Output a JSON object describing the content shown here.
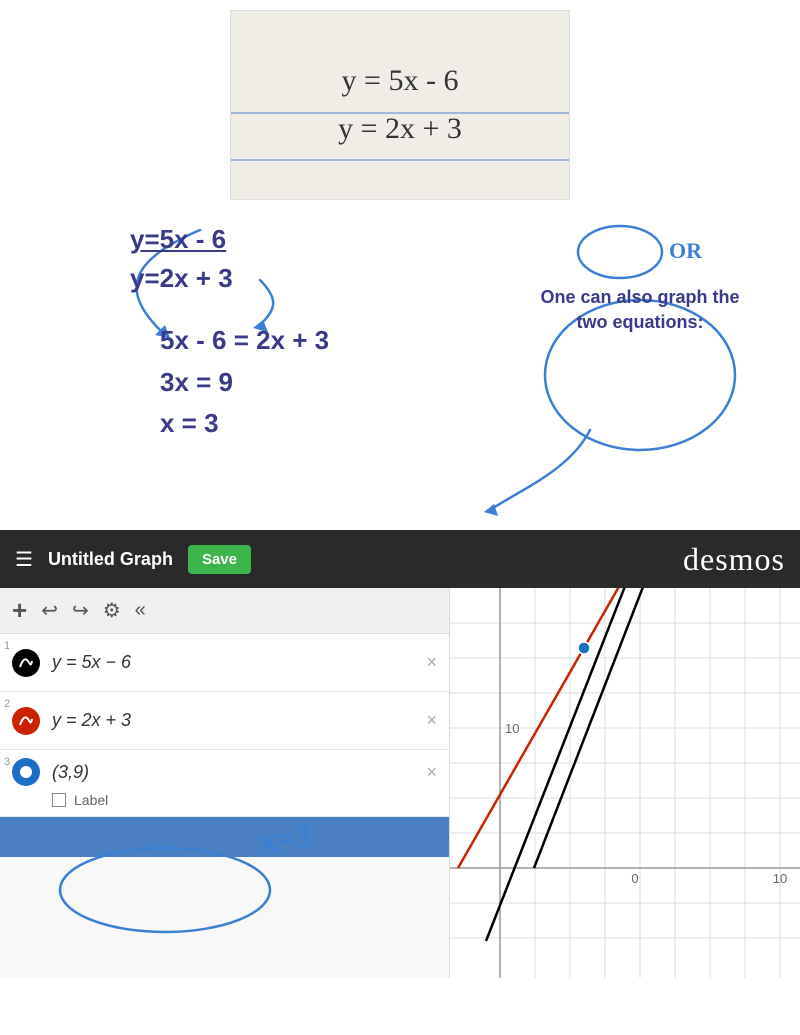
{
  "header": {
    "title": "Untitled Graph",
    "save_label": "Save",
    "logo": "desmos"
  },
  "photo": {
    "line1": "y = 5x - 6",
    "line2": "y = 2x + 3"
  },
  "annotations": {
    "eq1": "y=5x - 6",
    "eq2": "y=2x + 3",
    "step1": "5x - 6 = 2x + 3",
    "step2": "3x = 9",
    "step3": "x = 3",
    "or_label": "OR",
    "speech": "One can also graph the two equations:",
    "x3_annotation": "x=3"
  },
  "toolbar": {
    "add_label": "+",
    "undo_label": "↩",
    "redo_label": "↪",
    "settings_label": "⚙",
    "collapse_label": "«"
  },
  "expressions": [
    {
      "number": "1",
      "color": "black",
      "formula": "y = 5x − 6",
      "show_close": true
    },
    {
      "number": "2",
      "color": "red",
      "formula": "y = 2x + 3",
      "show_close": true
    },
    {
      "number": "3",
      "color": "blue",
      "formula": "(3,9)",
      "show_close": true,
      "has_label": true,
      "label_text": "Label"
    }
  ],
  "graph": {
    "x_label": "0",
    "x_max": "10",
    "y_label": "10",
    "intersection_note": "x=3, y=9"
  }
}
